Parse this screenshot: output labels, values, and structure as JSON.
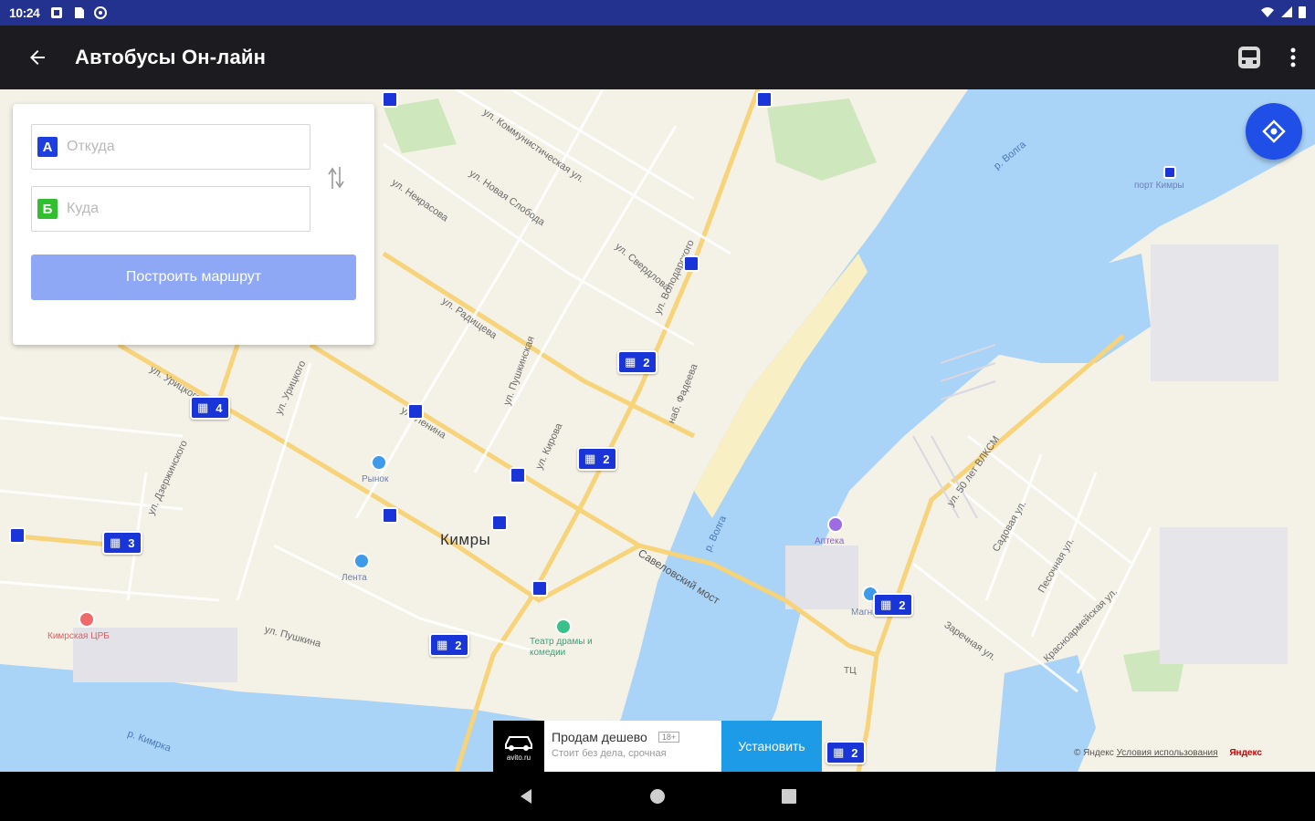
{
  "status_bar": {
    "time": "10:24"
  },
  "app_bar": {
    "title": "Автобусы Он-лайн"
  },
  "route_form": {
    "from_badge": "А",
    "from_placeholder": "Откуда",
    "to_badge": "Б",
    "to_placeholder": "Куда",
    "build_label": "Построить маршрут"
  },
  "map": {
    "city": "Кимры",
    "streets": [
      "ул. Коммунистическая ул.",
      "ул. Новая Слобода",
      "ул. Некрасова",
      "ул. Радищева",
      "ул. Свердлова",
      "ул. Урицкого",
      "ул. Ленина",
      "ул. Кирова",
      "Савеловский мост",
      "наб. Фадеева",
      "ул. Пушкина",
      "ул. 50 лет ВЛКСМ",
      "Садовая ул.",
      "Песочная ул.",
      "Красноармейская ул.",
      "ул. Володарского",
      "ул. Пушкинская",
      "ул. Дзержинского",
      "ул. Урицкого",
      "Заречная ул."
    ],
    "rivers": [
      "р. Волга",
      "р. Волга",
      "р. Кимрка"
    ],
    "pois": [
      "Рынок",
      "Лента",
      "Кимрская ЦРБ",
      "Театр драмы и комедии",
      "Аптека",
      "Магнит",
      "порт Кимры",
      "ТЦ"
    ],
    "bus_markers": [
      {
        "route": "2"
      },
      {
        "route": "2"
      },
      {
        "route": "4"
      },
      {
        "route": "3"
      },
      {
        "route": "2"
      },
      {
        "route": "2"
      },
      {
        "route": "2"
      }
    ]
  },
  "ad": {
    "logo_text": "avito.ru",
    "title": "Продам дешево",
    "tag": "18+",
    "subtitle": "Стоит без дела, срочная",
    "install_label": "Установить"
  },
  "copyright": {
    "prefix": "© Яндекс",
    "terms": "Условия использования",
    "brand": "Яндекс"
  }
}
